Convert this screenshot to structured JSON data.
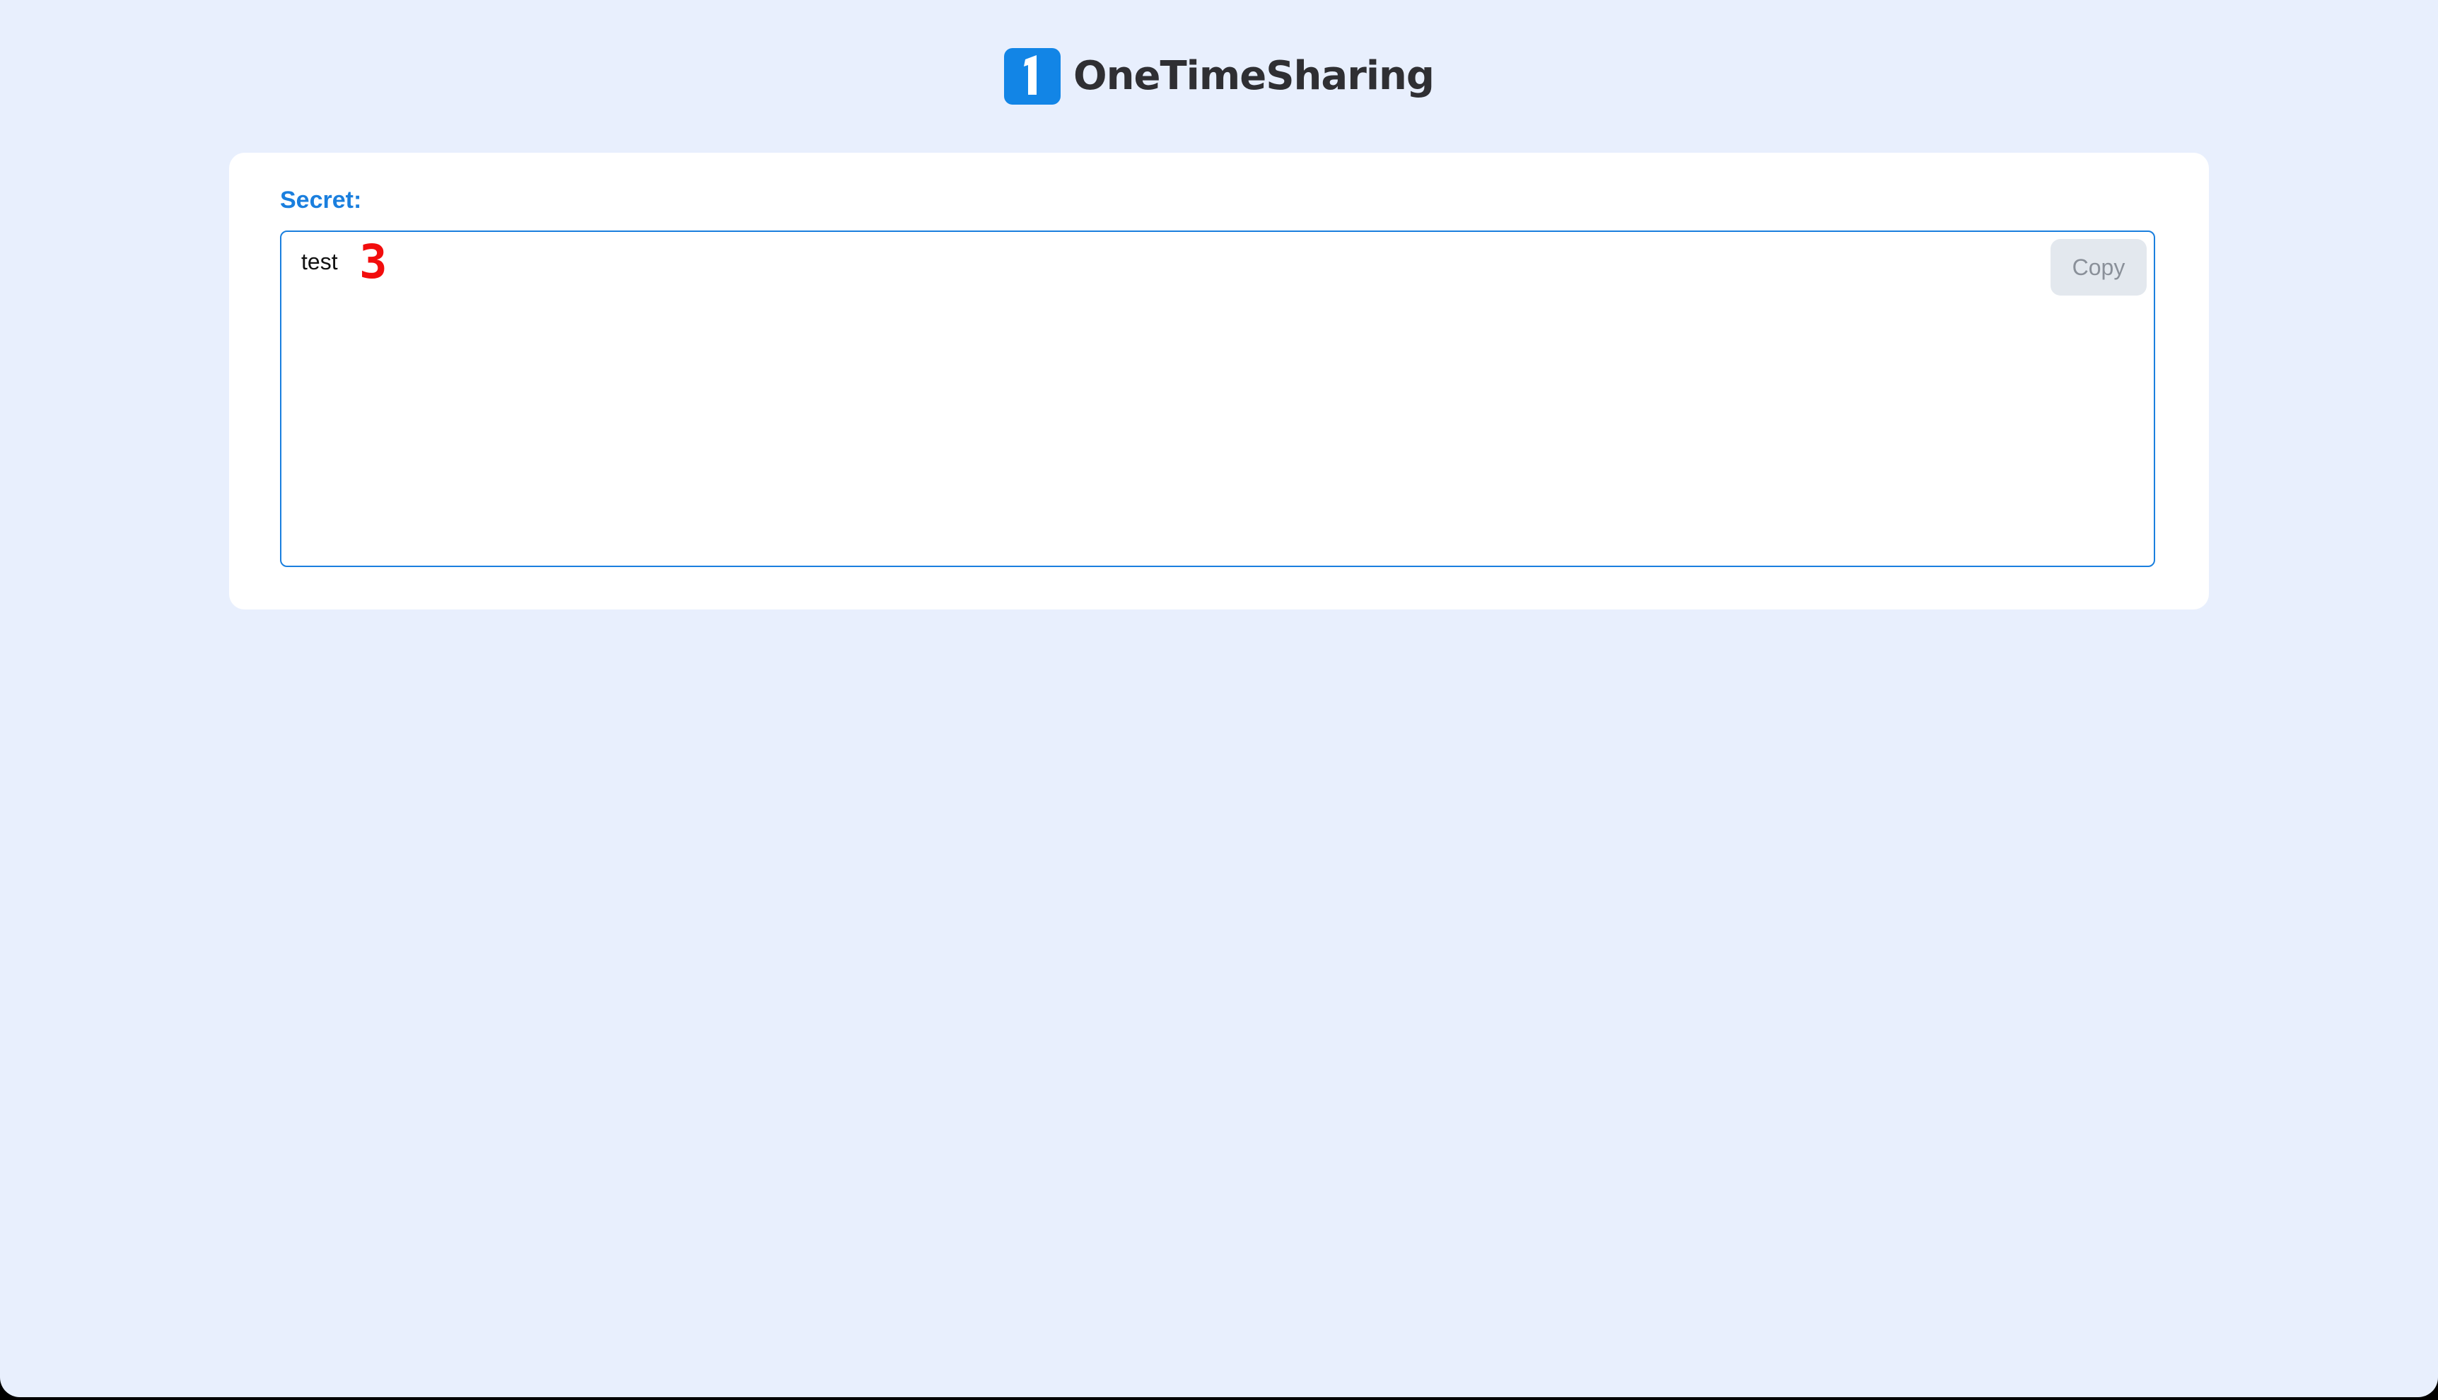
{
  "header": {
    "brand_name": "OneTimeSharing",
    "logo_icon": "one-digit-logo-icon"
  },
  "secret": {
    "label": "Secret:",
    "value": "test",
    "annotation_marker": "3",
    "copy_label": "Copy"
  },
  "colors": {
    "page_background": "#e8effd",
    "card_background": "#ffffff",
    "brand_blue": "#1285e6",
    "label_blue": "#1a7fde",
    "brand_text": "#2f2f33",
    "copy_button_bg": "#e3e8ee",
    "copy_button_text": "#8a9099",
    "annotation_red": "#f20d0d"
  }
}
